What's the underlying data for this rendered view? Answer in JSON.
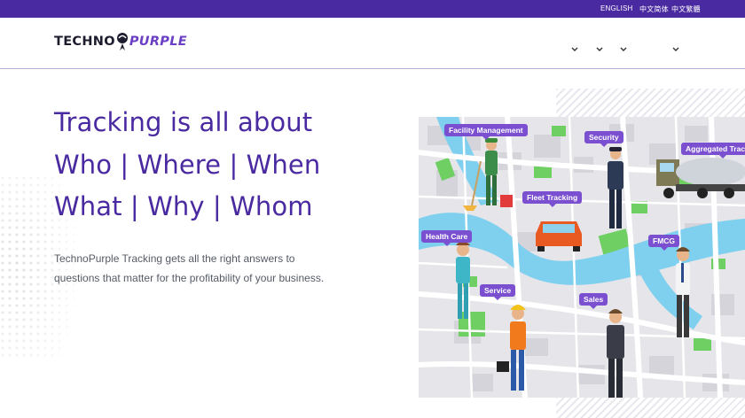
{
  "topbar": {
    "languages": [
      "ENGLISH",
      "中文简体",
      "中文繁體"
    ]
  },
  "header": {
    "logo": {
      "part1": "TECHNO",
      "part2": "PURPLE"
    },
    "nav_icons": [
      "chevron-down-icon",
      "chevron-down-icon",
      "chevron-down-icon",
      "chevron-down-icon"
    ]
  },
  "hero": {
    "line1": "Tracking is all about",
    "line2": "Who | Where | When",
    "line3": "What | Why | Whom",
    "subtitle": "TechnoPurple Tracking gets all the right answers to questions that matter for the profitability of your business."
  },
  "map": {
    "tags": [
      "Facility Management",
      "Security",
      "Aggregated Tracking",
      "Fleet Tracking",
      "Health Care",
      "FMCG",
      "Service",
      "Sales"
    ]
  },
  "colors": {
    "brand_purple": "#4a2aa0",
    "tag_purple": "#7a4fd0",
    "water": "#7fd0ee",
    "park": "#6fcf63"
  }
}
